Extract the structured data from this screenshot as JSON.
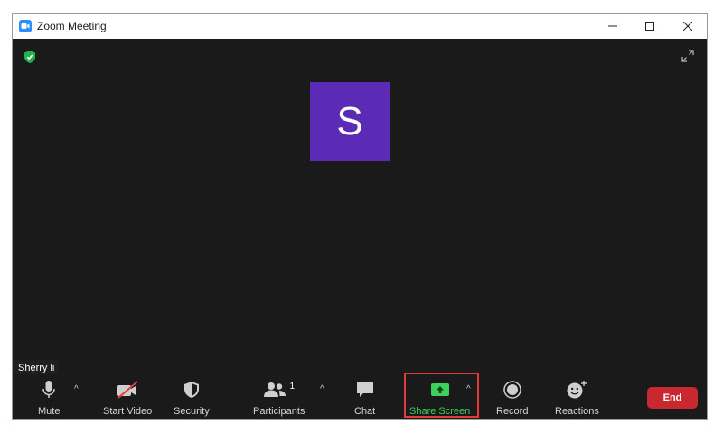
{
  "window": {
    "title": "Zoom Meeting",
    "minimize_icon": "minimize-icon",
    "maximize_icon": "maximize-icon",
    "close_icon": "close-icon"
  },
  "stage": {
    "security_badge_icon": "shield-check-icon",
    "fullscreen_icon": "expand-icon",
    "participant_initial": "S",
    "participant_name": "Sherry li",
    "avatar_color": "#5b2bb5"
  },
  "toolbar": {
    "mute_label": "Mute",
    "start_video_label": "Start Video",
    "security_label": "Security",
    "participants_label": "Participants",
    "participants_count": "1",
    "chat_label": "Chat",
    "share_screen_label": "Share Screen",
    "record_label": "Record",
    "reactions_label": "Reactions",
    "end_label": "End",
    "share_color": "#3bd15b",
    "end_color": "#c8282e",
    "highlight_color": "#e03a3a"
  }
}
